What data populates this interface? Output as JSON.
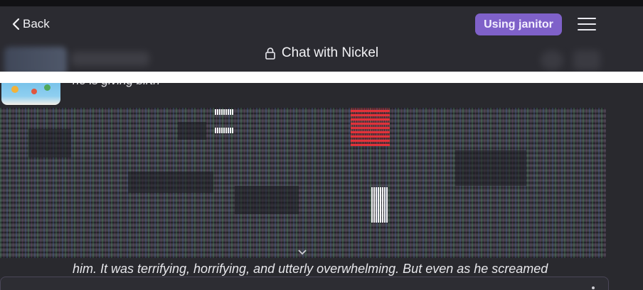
{
  "header": {
    "back_label": "Back",
    "janitor_label": "Using janitor",
    "title": "Chat with Nickel"
  },
  "messages": [
    {
      "text": "he is giving birth"
    },
    {
      "text": "him. It was terrifying, horrifying, and utterly overwhelming. But even as he screamed"
    }
  ],
  "colors": {
    "background": "#2b2b30",
    "accent_badge": "#7f61c9"
  },
  "icons": [
    "chevron-left-icon",
    "lock-icon",
    "hamburger-menu-icon",
    "chevron-down-icon"
  ]
}
